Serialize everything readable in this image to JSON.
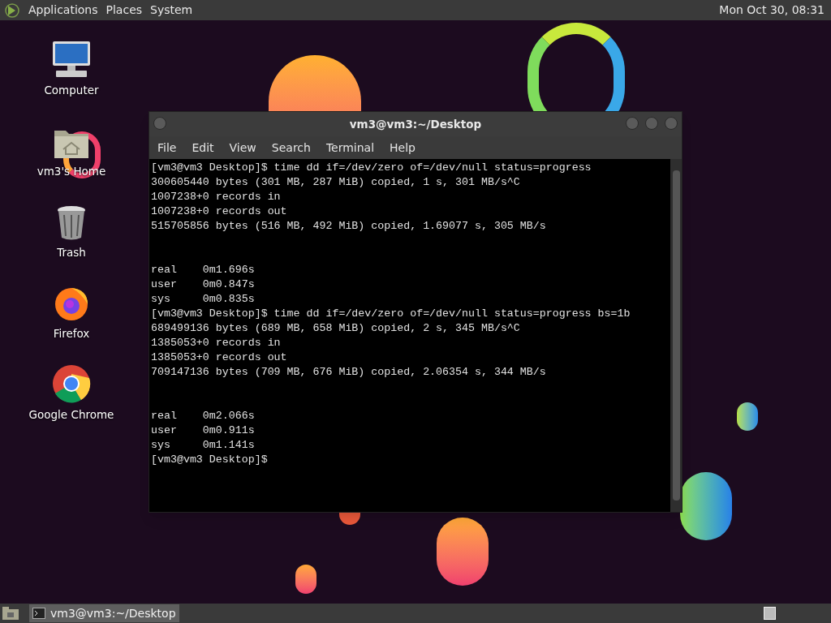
{
  "top_panel": {
    "menus": [
      "Applications",
      "Places",
      "System"
    ],
    "clock": "Mon Oct 30, 08:31"
  },
  "desktop_icons": [
    {
      "kind": "computer",
      "label": "Computer"
    },
    {
      "kind": "home",
      "label": "vm3's Home"
    },
    {
      "kind": "trash",
      "label": "Trash"
    },
    {
      "kind": "firefox",
      "label": "Firefox"
    },
    {
      "kind": "chrome",
      "label": "Google Chrome"
    }
  ],
  "terminal_window": {
    "title": "vm3@vm3:~/Desktop",
    "menu": [
      "File",
      "Edit",
      "View",
      "Search",
      "Terminal",
      "Help"
    ],
    "output_blocks": [
      [
        "[vm3@vm3 Desktop]$ time dd if=/dev/zero of=/dev/null status=progress",
        "300605440 bytes (301 MB, 287 MiB) copied, 1 s, 301 MB/s^C",
        "1007238+0 records in",
        "1007238+0 records out",
        "515705856 bytes (516 MB, 492 MiB) copied, 1.69077 s, 305 MB/s"
      ],
      [
        "real\t0m1.696s",
        "user\t0m0.847s",
        "sys\t0m0.835s",
        "[vm3@vm3 Desktop]$ time dd if=/dev/zero of=/dev/null status=progress bs=1b",
        "689499136 bytes (689 MB, 658 MiB) copied, 2 s, 345 MB/s^C",
        "1385053+0 records in",
        "1385053+0 records out",
        "709147136 bytes (709 MB, 676 MiB) copied, 2.06354 s, 344 MB/s"
      ],
      [
        "real\t0m2.066s",
        "user\t0m0.911s",
        "sys\t0m1.141s",
        "[vm3@vm3 Desktop]$"
      ]
    ]
  },
  "taskbar": {
    "tasks": [
      {
        "label": "vm3@vm3:~/Desktop",
        "selected": true
      }
    ]
  }
}
